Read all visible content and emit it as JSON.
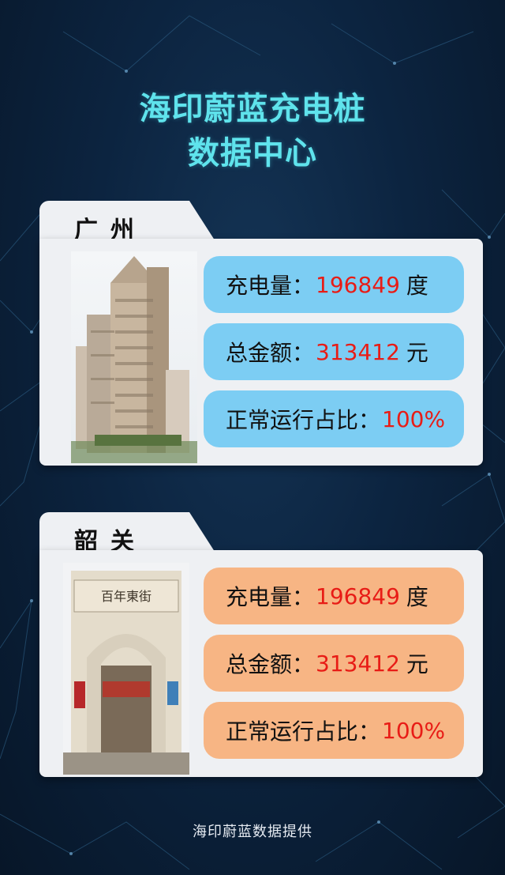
{
  "title_line1": "海印蔚蓝充电桩",
  "title_line2": "数据中心",
  "cards": [
    {
      "city": "广州",
      "rows": [
        {
          "label": "充电量：",
          "value": "196849",
          "unit": "度"
        },
        {
          "label": "总金额：",
          "value": "313412",
          "unit": "元"
        },
        {
          "label": "正常运行占比：",
          "value": "100%",
          "unit": ""
        }
      ]
    },
    {
      "city": "韶关",
      "rows": [
        {
          "label": "充电量：",
          "value": "196849",
          "unit": "度"
        },
        {
          "label": "总金额：",
          "value": "313412",
          "unit": "元"
        },
        {
          "label": "正常运行占比：",
          "value": "100%",
          "unit": ""
        }
      ],
      "photo_sign": "百年東街"
    }
  ],
  "footer": "海印蔚蓝数据提供",
  "colors": {
    "background": "#0c2440",
    "title": "#5fe3ec",
    "blue_row": "#7ccdf3",
    "orange_row": "#f7b584",
    "value": "#e81c16"
  }
}
